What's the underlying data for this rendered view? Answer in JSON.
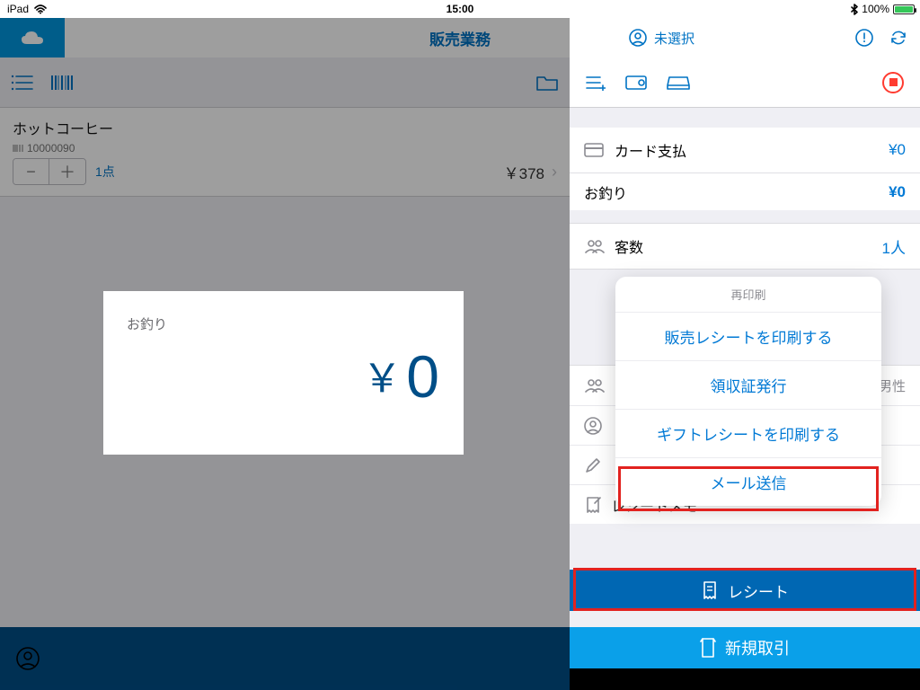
{
  "statusbar": {
    "device": "iPad",
    "time": "15:00",
    "battery": "100%"
  },
  "topnav": {
    "title": "販売業務",
    "user_label": "未選択"
  },
  "item": {
    "name": "ホットコーヒー",
    "sku": "10000090",
    "count_label": "1点",
    "price_display": "￥378"
  },
  "change_card": {
    "label": "お釣り",
    "currency": "￥",
    "amount": "0"
  },
  "right": {
    "card_payment_label": "カード支払",
    "card_payment_value": "¥0",
    "change_label": "お釣り",
    "change_value": "¥0",
    "guests_label": "客数",
    "guests_value": "1人",
    "gender_tag": "男性",
    "receipt_memo_label": "レシートメモ"
  },
  "popover": {
    "header": "再印刷",
    "opt_print_sales": "販売レシートを印刷する",
    "opt_issue_receipt": "領収証発行",
    "opt_print_gift": "ギフトレシートを印刷する",
    "opt_send_mail": "メール送信"
  },
  "footer": {
    "receipt_btn": "レシート",
    "new_tx_btn": "新規取引"
  }
}
